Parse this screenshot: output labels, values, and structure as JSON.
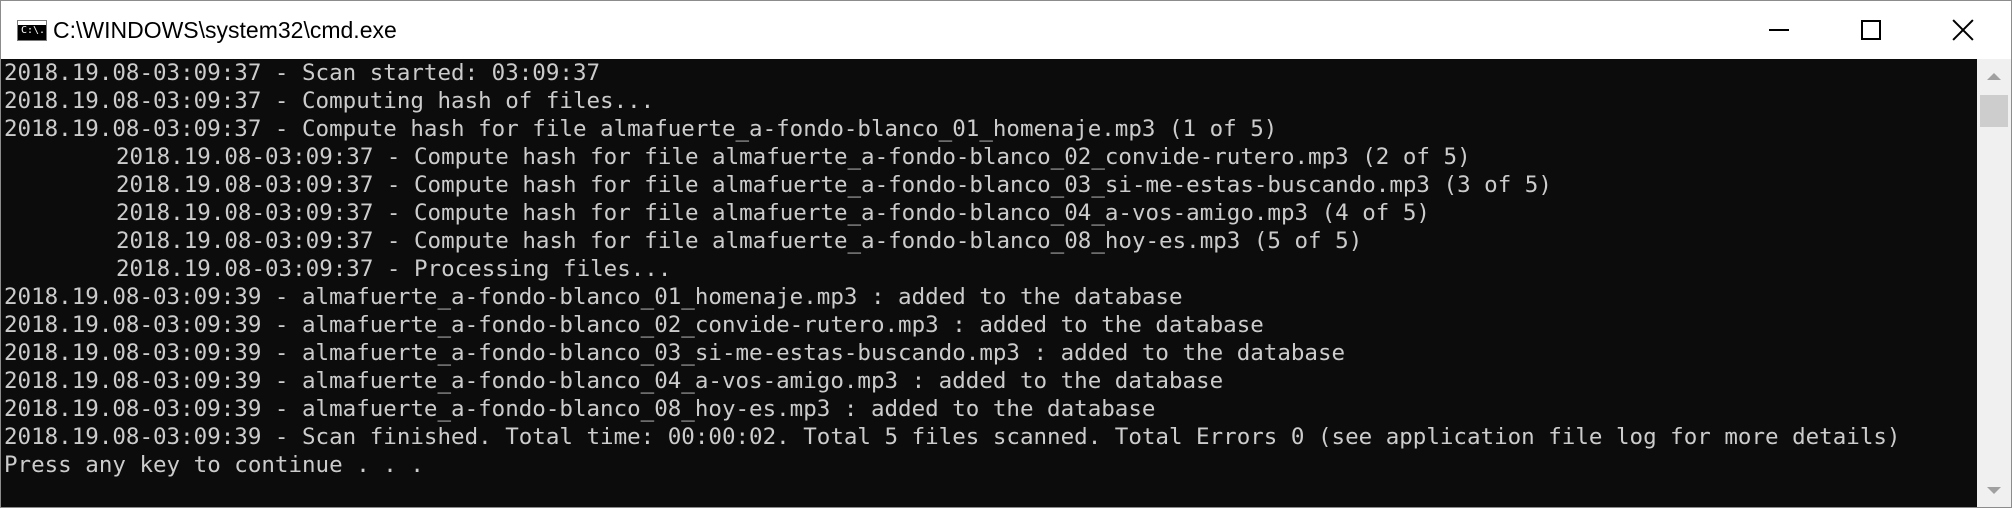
{
  "window": {
    "title": "C:\\WINDOWS\\system32\\cmd.exe",
    "icon": "cmd-console-icon",
    "icon_text": "C:\\."
  },
  "console": {
    "background": "#0c0c0c",
    "foreground": "#cccccc",
    "lines": [
      {
        "text": "2018.19.08-03:09:37 - Scan started: 03:09:37",
        "indent": false
      },
      {
        "text": "2018.19.08-03:09:37 - Computing hash of files...",
        "indent": false
      },
      {
        "text": "2018.19.08-03:09:37 - Compute hash for file almafuerte_a-fondo-blanco_01_homenaje.mp3 (1 of 5)",
        "indent": false
      },
      {
        "text": "2018.19.08-03:09:37 - Compute hash for file almafuerte_a-fondo-blanco_02_convide-rutero.mp3 (2 of 5)",
        "indent": true
      },
      {
        "text": "2018.19.08-03:09:37 - Compute hash for file almafuerte_a-fondo-blanco_03_si-me-estas-buscando.mp3 (3 of 5)",
        "indent": true
      },
      {
        "text": "2018.19.08-03:09:37 - Compute hash for file almafuerte_a-fondo-blanco_04_a-vos-amigo.mp3 (4 of 5)",
        "indent": true
      },
      {
        "text": "2018.19.08-03:09:37 - Compute hash for file almafuerte_a-fondo-blanco_08_hoy-es.mp3 (5 of 5)",
        "indent": true
      },
      {
        "text": "2018.19.08-03:09:37 - Processing files...",
        "indent": true
      },
      {
        "text": "2018.19.08-03:09:39 - almafuerte_a-fondo-blanco_01_homenaje.mp3 : added to the database",
        "indent": false
      },
      {
        "text": "2018.19.08-03:09:39 - almafuerte_a-fondo-blanco_02_convide-rutero.mp3 : added to the database",
        "indent": false
      },
      {
        "text": "2018.19.08-03:09:39 - almafuerte_a-fondo-blanco_03_si-me-estas-buscando.mp3 : added to the database",
        "indent": false
      },
      {
        "text": "2018.19.08-03:09:39 - almafuerte_a-fondo-blanco_04_a-vos-amigo.mp3 : added to the database",
        "indent": false
      },
      {
        "text": "2018.19.08-03:09:39 - almafuerte_a-fondo-blanco_08_hoy-es.mp3 : added to the database",
        "indent": false
      },
      {
        "text": "2018.19.08-03:09:39 - Scan finished. Total time: 00:00:02. Total 5 files scanned. Total Errors 0 (see application file log for more details)",
        "indent": false
      },
      {
        "text": "Press any key to continue . . .",
        "indent": false
      }
    ]
  },
  "controls": {
    "minimize_icon": "minimize-icon",
    "maximize_icon": "maximize-icon",
    "close_icon": "close-icon"
  }
}
